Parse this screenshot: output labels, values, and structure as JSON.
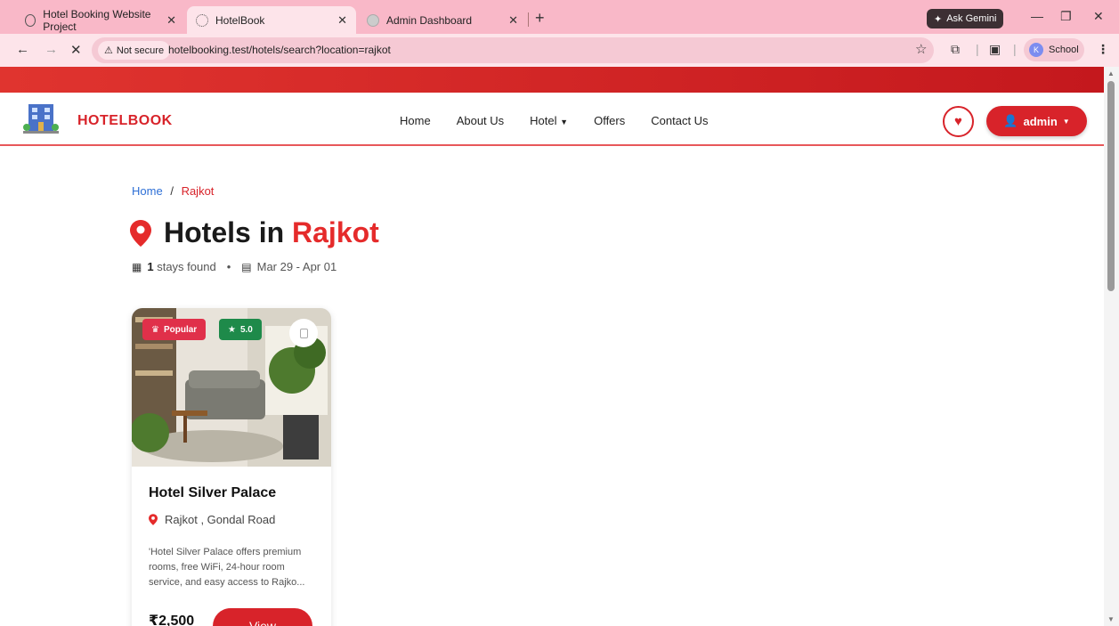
{
  "browser": {
    "tabs": [
      {
        "label": "Hotel Booking Website Project",
        "close": "✕"
      },
      {
        "label": "HotelBook",
        "close": "✕"
      },
      {
        "label": "Admin Dashboard",
        "close": "✕"
      }
    ],
    "new_tab": "+",
    "ask_gemini": "Ask Gemini",
    "not_secure": "Not secure",
    "url": "hotelbooking.test/hotels/search?location=rajkot",
    "profile_initial": "K",
    "profile_name": "School"
  },
  "site": {
    "brand": "HOTELBOOK",
    "menu": [
      "Home",
      "About Us",
      "Hotel",
      "Offers",
      "Contact Us"
    ],
    "admin_label": "admin",
    "accent": "#d8232a"
  },
  "breadcrumb": {
    "home": "Home",
    "sep": "/",
    "current": "Rajkot"
  },
  "heading": {
    "prefix": "Hotels in",
    "city": "Rajkot"
  },
  "meta": {
    "count": "1",
    "count_suffix": "stays found",
    "dot": "•",
    "dates": "Mar 29 - Apr 01"
  },
  "hotels": [
    {
      "badge_popular": "Popular",
      "rating": "5.0",
      "name": "Hotel Silver Palace",
      "location": "Rajkot , Gondal Road",
      "description": "'Hotel Silver Palace offers premium rooms, free WiFi, 24-hour room service, and easy access to Rajko...",
      "price": "₹2,500",
      "cta": "View"
    }
  ]
}
